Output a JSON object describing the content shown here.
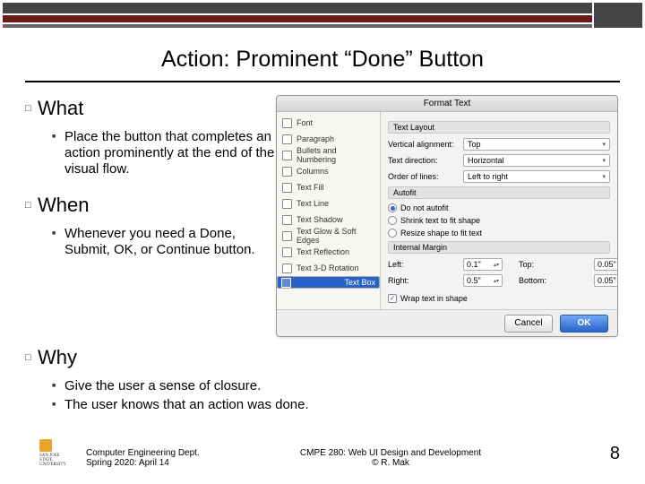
{
  "title": "Action: Prominent “Done” Button",
  "sections": [
    {
      "heading": "What",
      "items": [
        "Place the button that completes an action prominently at the end of the visual flow."
      ]
    },
    {
      "heading": "When",
      "items": [
        "Whenever you need a Done, Submit, OK, or Continue button."
      ]
    },
    {
      "heading": "Why",
      "items": [
        "Give the user a sense of closure.",
        "The user knows that an action was done."
      ]
    }
  ],
  "footer": {
    "dept1": "Computer Engineering Dept.",
    "dept2": "Spring 2020: April 14",
    "course": "CMPE 280: Web UI Design and Development",
    "author": "© R. Mak",
    "page": "8",
    "univ": "SAN JOSE STATE",
    "univ2": "UNIVERSITY"
  },
  "dialog": {
    "title": "Format Text",
    "side": [
      "Font",
      "Paragraph",
      "Bullets and Numbering",
      "Columns",
      "Text Fill",
      "Text Line",
      "Text Shadow",
      "Text Glow & Soft Edges",
      "Text Reflection",
      "Text 3-D Rotation",
      "Text Box"
    ],
    "side_selected": 10,
    "layout": {
      "head": "Text Layout",
      "fields": {
        "valign_label": "Vertical alignment:",
        "valign": "Top",
        "dir_label": "Text direction:",
        "dir": "Horizontal",
        "order_label": "Order of lines:",
        "order": "Left to right"
      }
    },
    "autofit": {
      "head": "Autofit",
      "opts": [
        "Do not autofit",
        "Shrink text to fit shape",
        "Resize shape to fit text"
      ],
      "selected": 0
    },
    "margin": {
      "head": "Internal Margin",
      "left_l": "Left:",
      "left_v": "0.1\"",
      "right_l": "Right:",
      "right_v": "0.5\"",
      "top_l": "Top:",
      "top_v": "0.05\"",
      "bottom_l": "Bottom:",
      "bottom_v": "0.05\"",
      "wrap": "Wrap text in shape",
      "wrap_on": true
    },
    "buttons": {
      "cancel": "Cancel",
      "ok": "OK"
    }
  }
}
